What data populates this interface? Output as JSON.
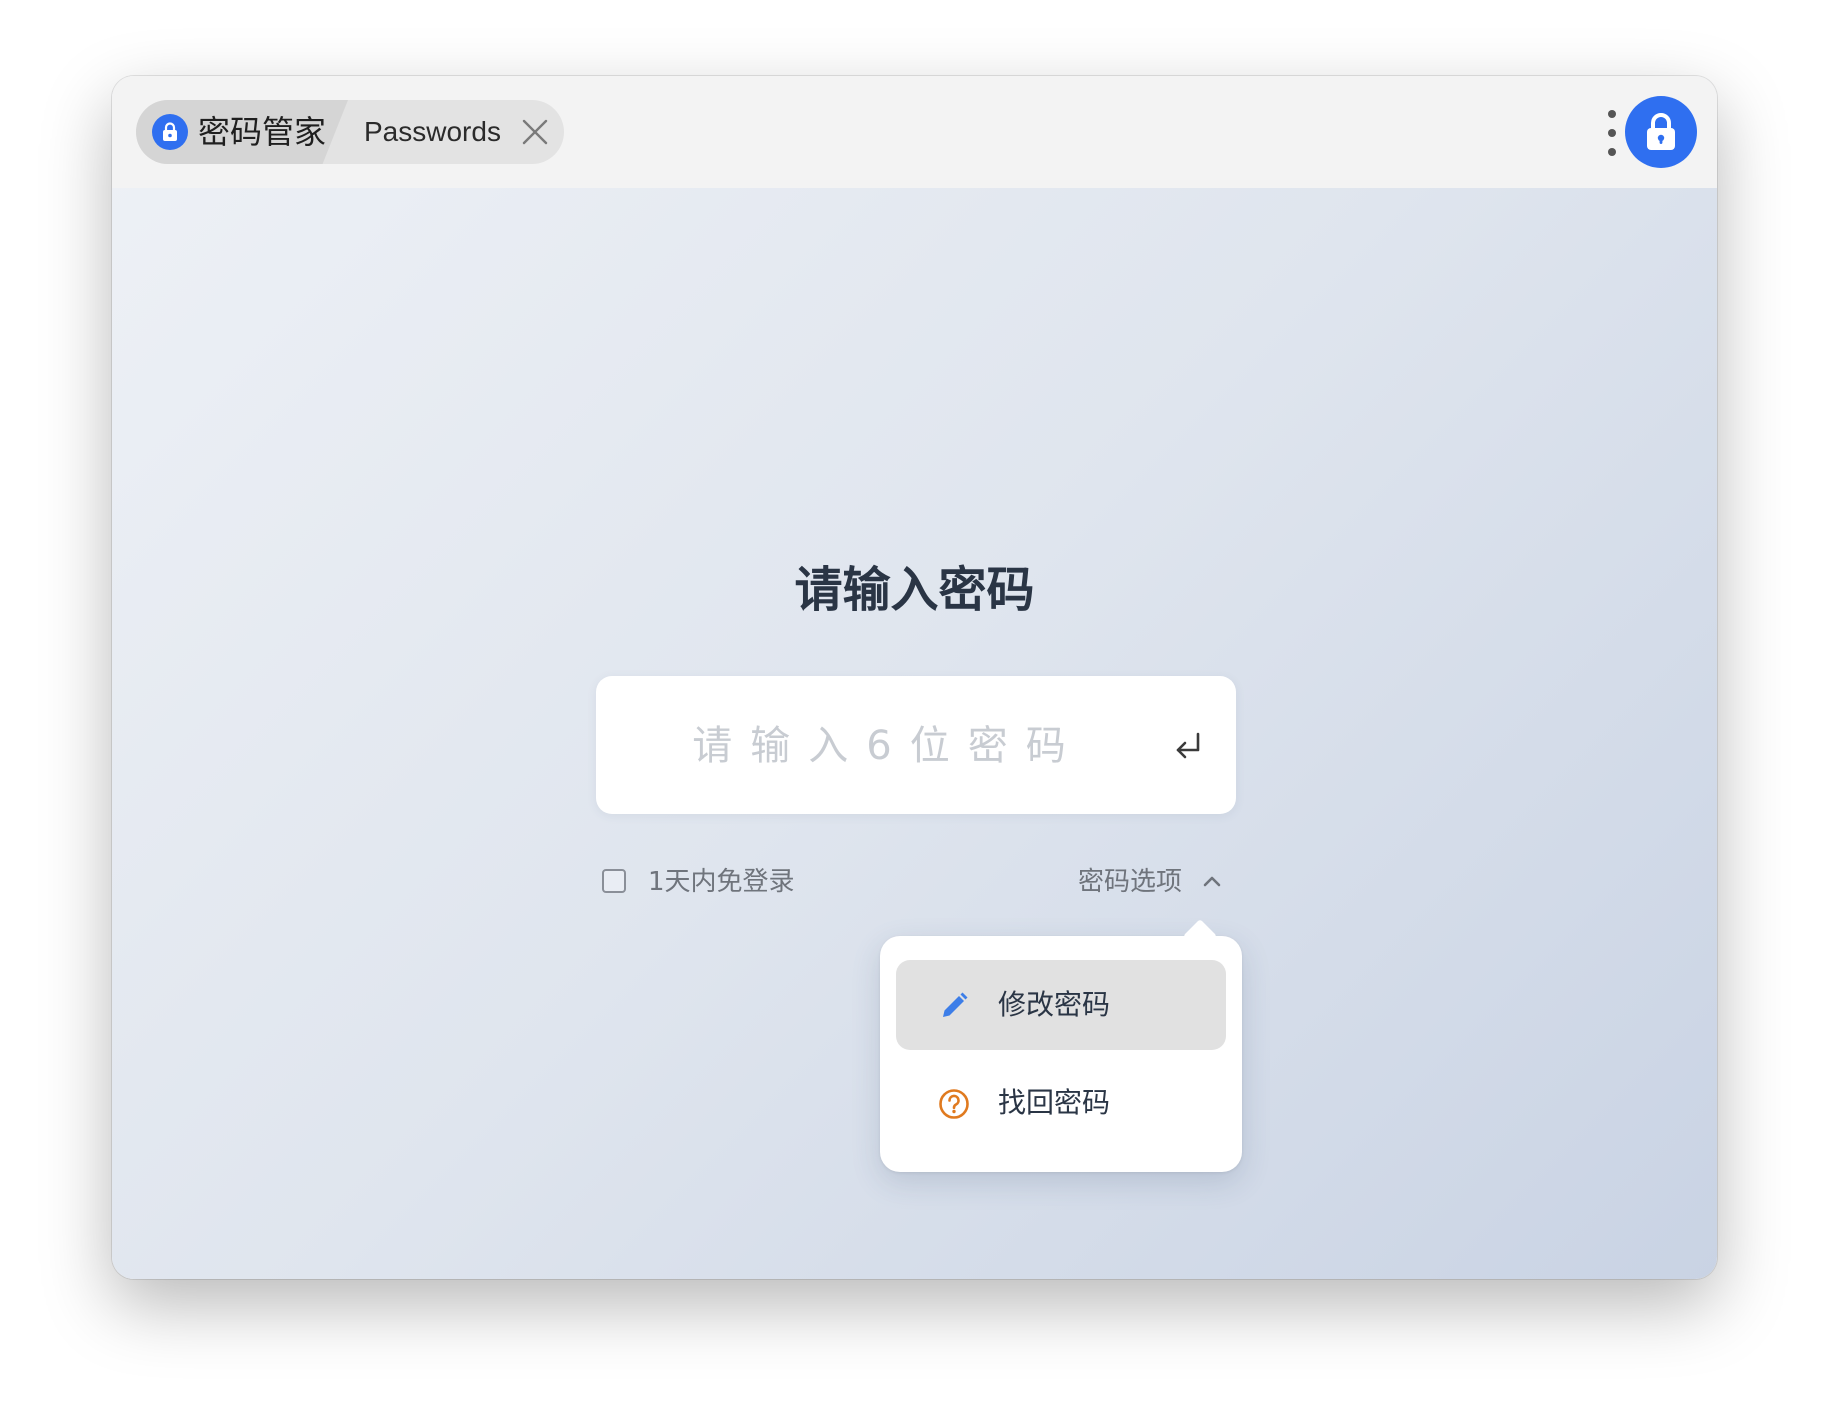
{
  "tab": {
    "app_title": "密码管家",
    "label": "Passwords",
    "app_icon": "lock-icon",
    "close_icon": "close-icon"
  },
  "toolbar": {
    "more_icon": "more-vertical-icon",
    "lock_icon": "lock-icon"
  },
  "login": {
    "heading": "请输入密码",
    "password_placeholder": "请输入6位密码",
    "password_value": "",
    "enter_icon": "enter-return-icon",
    "remember_label": "1天内免登录",
    "remember_checked": false,
    "options_label": "密码选项",
    "options_icon": "chevron-up-icon"
  },
  "menu": {
    "items": [
      {
        "label": "修改密码",
        "icon": "pencil-icon",
        "icon_color": "#3d7ee8",
        "active": true
      },
      {
        "label": "找回密码",
        "icon": "question-circle-icon",
        "icon_color": "#e07a1f",
        "active": false
      }
    ]
  },
  "colors": {
    "accent": "#2f6ff0",
    "heading": "#2a3545",
    "muted_text": "#6f747c"
  }
}
